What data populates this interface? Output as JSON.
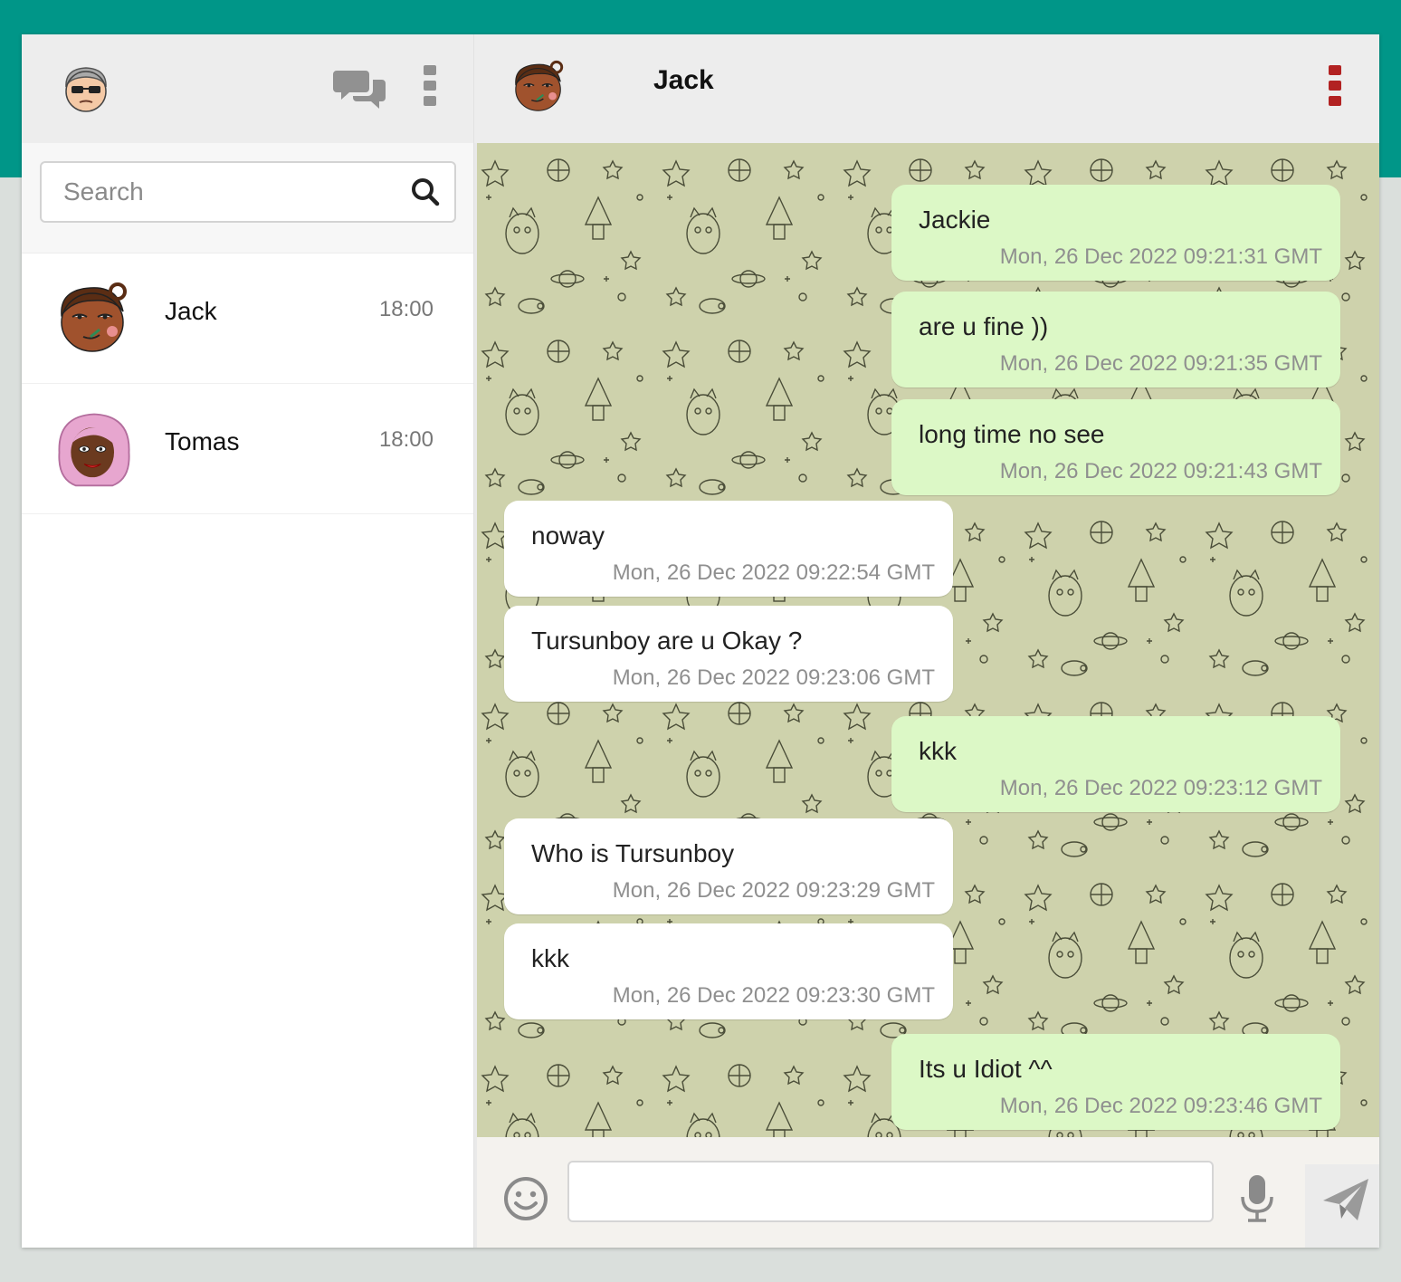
{
  "sidebar": {
    "header": {
      "avatar_icon": "user-avatar-grey-hair",
      "chat_icon": "chat-bubbles-icon",
      "menu_icon": "vertical-dots-icon"
    },
    "search": {
      "placeholder": "Search",
      "value": "",
      "icon": "search-icon"
    },
    "contacts": [
      {
        "name": "Jack",
        "time": "18:00",
        "avatar": "avatar-jack"
      },
      {
        "name": "Tomas",
        "time": "18:00",
        "avatar": "avatar-tomas"
      }
    ]
  },
  "chat": {
    "peer_name": "Jack",
    "peer_avatar": "avatar-jack",
    "menu_icon": "vertical-dots-icon",
    "menu_color": "#b22222",
    "messages": [
      {
        "direction": "out",
        "text": "Jackie",
        "time": "Mon, 26 Dec 2022 09:21:31 GMT"
      },
      {
        "direction": "out",
        "text": "are u fine ))",
        "time": "Mon, 26 Dec 2022 09:21:35 GMT"
      },
      {
        "direction": "out",
        "text": "long time no see",
        "time": "Mon, 26 Dec 2022 09:21:43 GMT"
      },
      {
        "direction": "in",
        "text": "noway",
        "time": "Mon, 26 Dec 2022 09:22:54 GMT"
      },
      {
        "direction": "in",
        "text": "Tursunboy are u Okay ?",
        "time": "Mon, 26 Dec 2022 09:23:06 GMT"
      },
      {
        "direction": "out",
        "text": "kkk",
        "time": "Mon, 26 Dec 2022 09:23:12 GMT"
      },
      {
        "direction": "in",
        "text": "Who is Tursunboy",
        "time": "Mon, 26 Dec 2022 09:23:29 GMT"
      },
      {
        "direction": "in",
        "text": "kkk",
        "time": "Mon, 26 Dec 2022 09:23:30 GMT"
      },
      {
        "direction": "out",
        "text": "Its u Idiot ^^",
        "time": "Mon, 26 Dec 2022 09:23:46 GMT"
      }
    ]
  },
  "composer": {
    "input_value": "",
    "input_placeholder": "",
    "emoji_icon": "smiley-icon",
    "mic_icon": "microphone-icon",
    "send_icon": "paper-plane-icon"
  },
  "colors": {
    "brand": "#009688",
    "outgoing_bubble": "#dcf8c6",
    "incoming_bubble": "#ffffff",
    "chat_background": "#ced2ac"
  }
}
